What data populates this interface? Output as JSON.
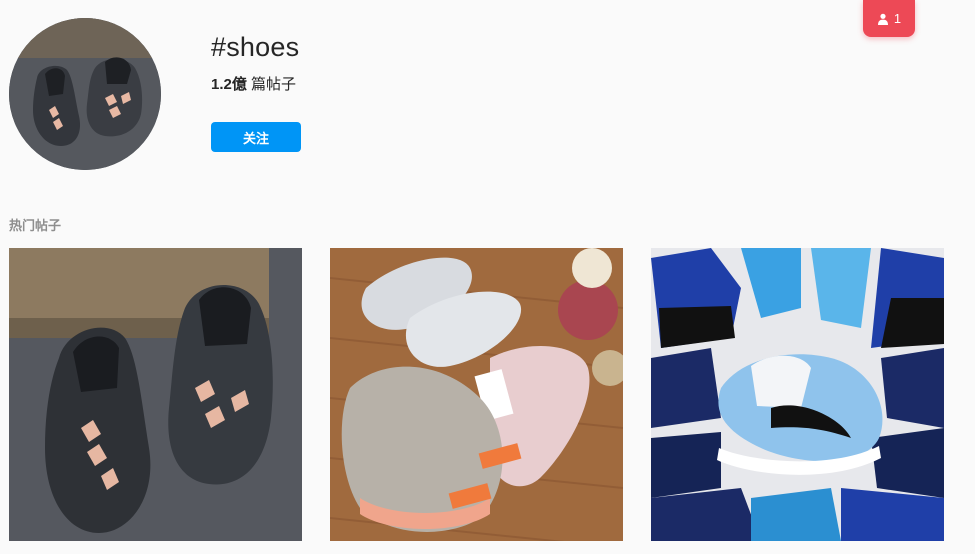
{
  "hashtag": {
    "title": "#shoes",
    "post_count": "1.2億",
    "post_count_suffix": " 篇帖子",
    "follow_label": "关注",
    "avatar_icon": "yeezy-700-avatar-image"
  },
  "notifications": {
    "count": "1",
    "icon": "person-icon",
    "color": "#ed4956"
  },
  "top_posts": {
    "label": "热门帖子",
    "items": [
      {
        "name": "post-yeezy-700-v3",
        "icon": "sneaker-photo"
      },
      {
        "name": "post-yeezy-350-v2",
        "icon": "sneaker-photo"
      },
      {
        "name": "post-air-jordan-1",
        "icon": "sneaker-photo"
      }
    ]
  },
  "colors": {
    "accent": "#0095f6",
    "background": "#fafafa",
    "muted": "#8e8e8e"
  }
}
